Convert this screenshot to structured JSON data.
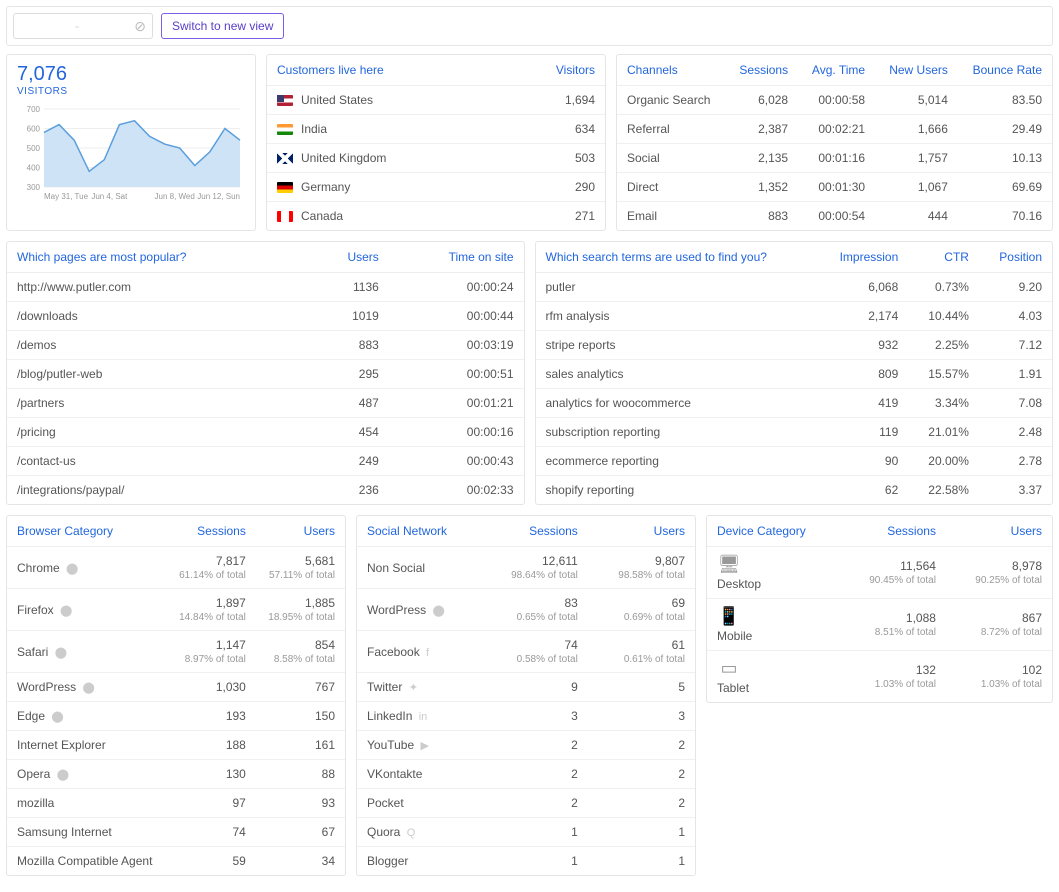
{
  "topbar": {
    "select_placeholder": "-",
    "switch_label": "Switch to new view"
  },
  "visitors": {
    "value": "7,076",
    "label": "VISITORS",
    "chart_data": {
      "type": "area",
      "x_labels": [
        "May 31, Tue",
        "Jun 4, Sat",
        "Jun 8, Wed",
        "Jun 12, Sun"
      ],
      "y_ticks": [
        300,
        400,
        500,
        600,
        700
      ],
      "ylim": [
        300,
        700
      ],
      "values": [
        580,
        620,
        540,
        380,
        440,
        620,
        640,
        560,
        520,
        500,
        410,
        480,
        600,
        540
      ]
    }
  },
  "customers": {
    "title": "Customers live here",
    "col": "Visitors",
    "rows": [
      {
        "flag": "us",
        "country": "United States",
        "v": "1,694"
      },
      {
        "flag": "in",
        "country": "India",
        "v": "634"
      },
      {
        "flag": "gb",
        "country": "United Kingdom",
        "v": "503"
      },
      {
        "flag": "de",
        "country": "Germany",
        "v": "290"
      },
      {
        "flag": "ca",
        "country": "Canada",
        "v": "271"
      }
    ]
  },
  "channels": {
    "cols": [
      "Channels",
      "Sessions",
      "Avg. Time",
      "New Users",
      "Bounce Rate"
    ],
    "rows": [
      [
        "Organic Search",
        "6,028",
        "00:00:58",
        "5,014",
        "83.50"
      ],
      [
        "Referral",
        "2,387",
        "00:02:21",
        "1,666",
        "29.49"
      ],
      [
        "Social",
        "2,135",
        "00:01:16",
        "1,757",
        "10.13"
      ],
      [
        "Direct",
        "1,352",
        "00:01:30",
        "1,067",
        "69.69"
      ],
      [
        "Email",
        "883",
        "00:00:54",
        "444",
        "70.16"
      ]
    ]
  },
  "pages": {
    "title": "Which pages are most popular?",
    "cols": [
      "Users",
      "Time on site"
    ],
    "rows": [
      [
        "http://www.putler.com",
        "1136",
        "00:00:24"
      ],
      [
        "/downloads",
        "1019",
        "00:00:44"
      ],
      [
        "/demos",
        "883",
        "00:03:19"
      ],
      [
        "/blog/putler-web",
        "295",
        "00:00:51"
      ],
      [
        "/partners",
        "487",
        "00:01:21"
      ],
      [
        "/pricing",
        "454",
        "00:00:16"
      ],
      [
        "/contact-us",
        "249",
        "00:00:43"
      ],
      [
        "/integrations/paypal/",
        "236",
        "00:02:33"
      ]
    ]
  },
  "searchterms": {
    "title": "Which search terms are used to find you?",
    "cols": [
      "Impression",
      "CTR",
      "Position"
    ],
    "rows": [
      [
        "putler",
        "6,068",
        "0.73%",
        "9.20"
      ],
      [
        "rfm analysis",
        "2,174",
        "10.44%",
        "4.03"
      ],
      [
        "stripe reports",
        "932",
        "2.25%",
        "7.12"
      ],
      [
        "sales analytics",
        "809",
        "15.57%",
        "1.91"
      ],
      [
        "analytics for woocommerce",
        "419",
        "3.34%",
        "7.08"
      ],
      [
        "subscription reporting",
        "119",
        "21.01%",
        "2.48"
      ],
      [
        "ecommerce reporting",
        "90",
        "20.00%",
        "2.78"
      ],
      [
        "shopify reporting",
        "62",
        "22.58%",
        "3.37"
      ]
    ]
  },
  "browsers": {
    "title": "Browser Category",
    "cols": [
      "Sessions",
      "Users"
    ],
    "rows": [
      {
        "n": "Chrome",
        "icon": "⬤",
        "s": "7,817",
        "sp": "61.14% of total",
        "u": "5,681",
        "up": "57.11% of total"
      },
      {
        "n": "Firefox",
        "icon": "⬤",
        "s": "1,897",
        "sp": "14.84% of total",
        "u": "1,885",
        "up": "18.95% of total"
      },
      {
        "n": "Safari",
        "icon": "⬤",
        "s": "1,147",
        "sp": "8.97% of total",
        "u": "854",
        "up": "8.58% of total"
      },
      {
        "n": "WordPress",
        "icon": "⬤",
        "s": "1,030",
        "sp": "",
        "u": "767",
        "up": ""
      },
      {
        "n": "Edge",
        "icon": "⬤",
        "s": "193",
        "sp": "",
        "u": "150",
        "up": ""
      },
      {
        "n": "Internet Explorer",
        "icon": "",
        "s": "188",
        "sp": "",
        "u": "161",
        "up": ""
      },
      {
        "n": "Opera",
        "icon": "⬤",
        "s": "130",
        "sp": "",
        "u": "88",
        "up": ""
      },
      {
        "n": "mozilla",
        "icon": "",
        "s": "97",
        "sp": "",
        "u": "93",
        "up": ""
      },
      {
        "n": "Samsung Internet",
        "icon": "",
        "s": "74",
        "sp": "",
        "u": "67",
        "up": ""
      },
      {
        "n": "Mozilla Compatible Agent",
        "icon": "",
        "s": "59",
        "sp": "",
        "u": "34",
        "up": ""
      }
    ]
  },
  "social": {
    "title": "Social Network",
    "cols": [
      "Sessions",
      "Users"
    ],
    "rows": [
      {
        "n": "Non Social",
        "icon": "",
        "s": "12,611",
        "sp": "98.64% of total",
        "u": "9,807",
        "up": "98.58% of total"
      },
      {
        "n": "WordPress",
        "icon": "⬤",
        "s": "83",
        "sp": "0.65% of total",
        "u": "69",
        "up": "0.69% of total"
      },
      {
        "n": "Facebook",
        "icon": "f",
        "s": "74",
        "sp": "0.58% of total",
        "u": "61",
        "up": "0.61% of total"
      },
      {
        "n": "Twitter",
        "icon": "✦",
        "s": "9",
        "sp": "",
        "u": "5",
        "up": ""
      },
      {
        "n": "LinkedIn",
        "icon": "in",
        "s": "3",
        "sp": "",
        "u": "3",
        "up": ""
      },
      {
        "n": "YouTube",
        "icon": "▶",
        "s": "2",
        "sp": "",
        "u": "2",
        "up": ""
      },
      {
        "n": "VKontakte",
        "icon": "",
        "s": "2",
        "sp": "",
        "u": "2",
        "up": ""
      },
      {
        "n": "Pocket",
        "icon": "",
        "s": "2",
        "sp": "",
        "u": "2",
        "up": ""
      },
      {
        "n": "Quora",
        "icon": "Q",
        "s": "1",
        "sp": "",
        "u": "1",
        "up": ""
      },
      {
        "n": "Blogger",
        "icon": "",
        "s": "1",
        "sp": "",
        "u": "1",
        "up": ""
      }
    ]
  },
  "devices": {
    "title": "Device Category",
    "cols": [
      "Sessions",
      "Users"
    ],
    "rows": [
      {
        "n": "Desktop",
        "icon": "desktop",
        "s": "11,564",
        "sp": "90.45% of total",
        "u": "8,978",
        "up": "90.25% of total"
      },
      {
        "n": "Mobile",
        "icon": "mobile",
        "s": "1,088",
        "sp": "8.51% of total",
        "u": "867",
        "up": "8.72% of total"
      },
      {
        "n": "Tablet",
        "icon": "tablet",
        "s": "132",
        "sp": "1.03% of total",
        "u": "102",
        "up": "1.03% of total"
      }
    ]
  }
}
